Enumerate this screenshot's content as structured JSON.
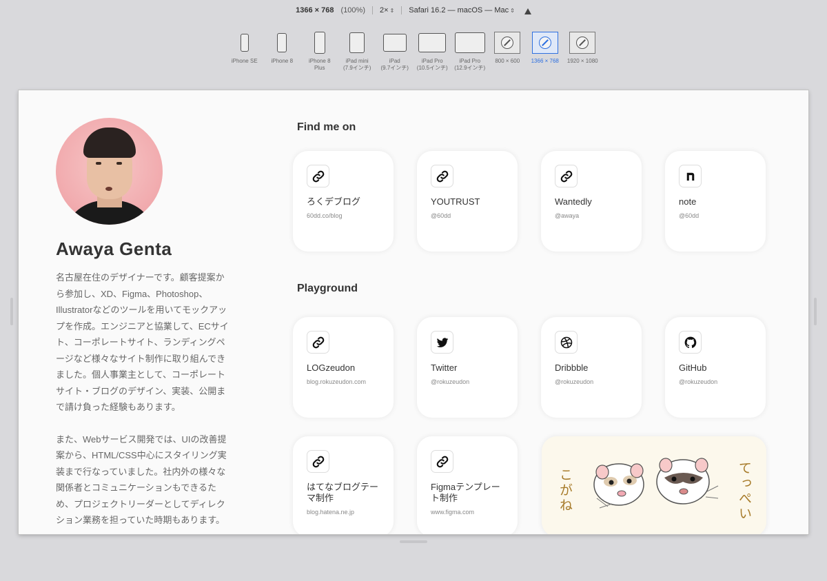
{
  "toolbar": {
    "resolution": "1366 × 768",
    "zoom_percent": "(100%)",
    "scale": "2×",
    "user_agent": "Safari 16.2 — macOS — Mac"
  },
  "devices": [
    {
      "label": "iPhone SE",
      "kind": "phone",
      "active": false
    },
    {
      "label": "iPhone 8",
      "kind": "phone",
      "active": false
    },
    {
      "label": "iPhone 8\nPlus",
      "kind": "phone",
      "active": false
    },
    {
      "label": "iPad mini\n(7.9インチ)",
      "kind": "tablet",
      "active": false
    },
    {
      "label": "iPad\n(9.7インチ)",
      "kind": "tablet",
      "active": false
    },
    {
      "label": "iPad Pro\n(10.5インチ)",
      "kind": "tablet",
      "active": false
    },
    {
      "label": "iPad Pro\n(12.9インチ)",
      "kind": "tablet",
      "active": false
    },
    {
      "label": "800 × 600",
      "kind": "monitor",
      "active": false
    },
    {
      "label": "1366 × 768",
      "kind": "monitor",
      "active": true
    },
    {
      "label": "1920 × 1080",
      "kind": "monitor",
      "active": false
    }
  ],
  "profile": {
    "name": "Awaya Genta",
    "bio_1": "名古屋在住のデザイナーです。顧客提案から参加し、XD、Figma、Photoshop、Illustratorなどのツールを用いてモックアップを作成。エンジニアと協業して、ECサイト、コーポレートサイト、ランディングページなど様々なサイト制作に取り組んできました。個人事業主として、コーポレートサイト・ブログのデザイン、実装、公開まで請け負った経験もあります。",
    "bio_2": "また、Webサービス開発では、UIの改善提案から、HTML/CSS中心にスタイリング実装まで行なっていました。社内外の様々な関係者とコミュニケーションもできるため、プロジェクトリーダーとしてディレクション業務を担っていた時期もあります。"
  },
  "sections": {
    "find_me_on": "Find me on",
    "playground": "Playground"
  },
  "find_me_on": [
    {
      "title": "ろくデブログ",
      "sub": "60dd.co/blog",
      "icon": "link-icon"
    },
    {
      "title": "YOUTRUST",
      "sub": "@60dd",
      "icon": "link-icon"
    },
    {
      "title": "Wantedly",
      "sub": "@awaya",
      "icon": "link-icon"
    },
    {
      "title": "note",
      "sub": "@60dd",
      "icon": "note-icon"
    }
  ],
  "playground": [
    {
      "title": "LOGzeudon",
      "sub": "blog.rokuzeudon.com",
      "icon": "link-icon"
    },
    {
      "title": "Twitter",
      "sub": "@rokuzeudon",
      "icon": "twitter-icon"
    },
    {
      "title": "Dribbble",
      "sub": "@rokuzeudon",
      "icon": "dribbble-icon"
    },
    {
      "title": "GitHub",
      "sub": "@rokuzeudon",
      "icon": "github-icon"
    },
    {
      "title": "はてなブログテーマ制作",
      "sub": "blog.hatena.ne.jp",
      "icon": "link-icon"
    },
    {
      "title": "Figmaテンプレート制作",
      "sub": "www.figma.com",
      "icon": "link-icon"
    }
  ],
  "ferret_card": {
    "left_text": "こがね",
    "right_text": "てっぺい"
  }
}
